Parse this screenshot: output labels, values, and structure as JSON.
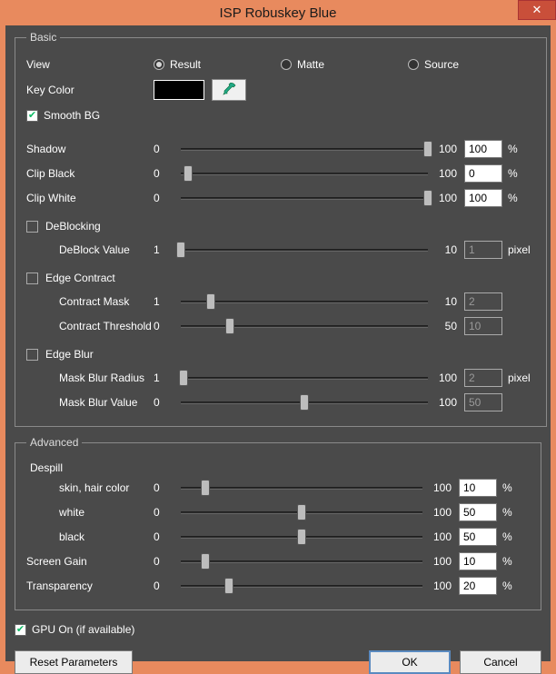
{
  "window": {
    "title": "ISP Robuskey Blue",
    "close": "✕"
  },
  "basic": {
    "legend": "Basic",
    "view_label": "View",
    "view": {
      "result": "Result",
      "matte": "Matte",
      "source": "Source",
      "selected": "result"
    },
    "key_color_label": "Key Color",
    "key_color": "#000000",
    "smooth_bg": {
      "label": "Smooth BG",
      "checked": true
    },
    "sliders": {
      "shadow": {
        "label": "Shadow",
        "min": "0",
        "max": "100",
        "value": "100",
        "unit": "%",
        "pos": 100,
        "enabled": true
      },
      "clip_black": {
        "label": "Clip Black",
        "min": "0",
        "max": "100",
        "value": "0",
        "unit": "%",
        "pos": 3,
        "enabled": true
      },
      "clip_white": {
        "label": "Clip White",
        "min": "0",
        "max": "100",
        "value": "100",
        "unit": "%",
        "pos": 100,
        "enabled": true
      }
    },
    "deblocking": {
      "label": "DeBlocking",
      "checked": false,
      "deblock_value": {
        "label": "DeBlock Value",
        "min": "1",
        "max": "10",
        "value": "1",
        "unit": "pixel",
        "pos": 0,
        "enabled": false
      }
    },
    "edge_contract": {
      "label": "Edge Contract",
      "checked": false,
      "contract_mask": {
        "label": "Contract Mask",
        "min": "1",
        "max": "10",
        "value": "2",
        "unit": "",
        "pos": 12,
        "enabled": false
      },
      "contract_threshold": {
        "label": "Contract Threshold",
        "min": "0",
        "max": "50",
        "value": "10",
        "unit": "",
        "pos": 20,
        "enabled": false
      }
    },
    "edge_blur": {
      "label": "Edge Blur",
      "checked": false,
      "mask_blur_radius": {
        "label": "Mask Blur Radius",
        "min": "1",
        "max": "100",
        "value": "2",
        "unit": "pixel",
        "pos": 1,
        "enabled": false
      },
      "mask_blur_value": {
        "label": "Mask Blur Value",
        "min": "0",
        "max": "100",
        "value": "50",
        "unit": "",
        "pos": 50,
        "enabled": false
      }
    }
  },
  "advanced": {
    "legend": "Advanced",
    "despill_label": "Despill",
    "despill": {
      "skin": {
        "label": "skin, hair color",
        "min": "0",
        "max": "100",
        "value": "10",
        "unit": "%",
        "pos": 10,
        "enabled": true
      },
      "white": {
        "label": "white",
        "min": "0",
        "max": "100",
        "value": "50",
        "unit": "%",
        "pos": 50,
        "enabled": true
      },
      "black": {
        "label": "black",
        "min": "0",
        "max": "100",
        "value": "50",
        "unit": "%",
        "pos": 50,
        "enabled": true
      }
    },
    "screen_gain": {
      "label": "Screen Gain",
      "min": "0",
      "max": "100",
      "value": "10",
      "unit": "%",
      "pos": 10,
      "enabled": true
    },
    "transparency": {
      "label": "Transparency",
      "min": "0",
      "max": "100",
      "value": "20",
      "unit": "%",
      "pos": 20,
      "enabled": true
    }
  },
  "gpu": {
    "label": "GPU On (if available)",
    "checked": true
  },
  "buttons": {
    "reset": "Reset Parameters",
    "ok": "OK",
    "cancel": "Cancel"
  }
}
